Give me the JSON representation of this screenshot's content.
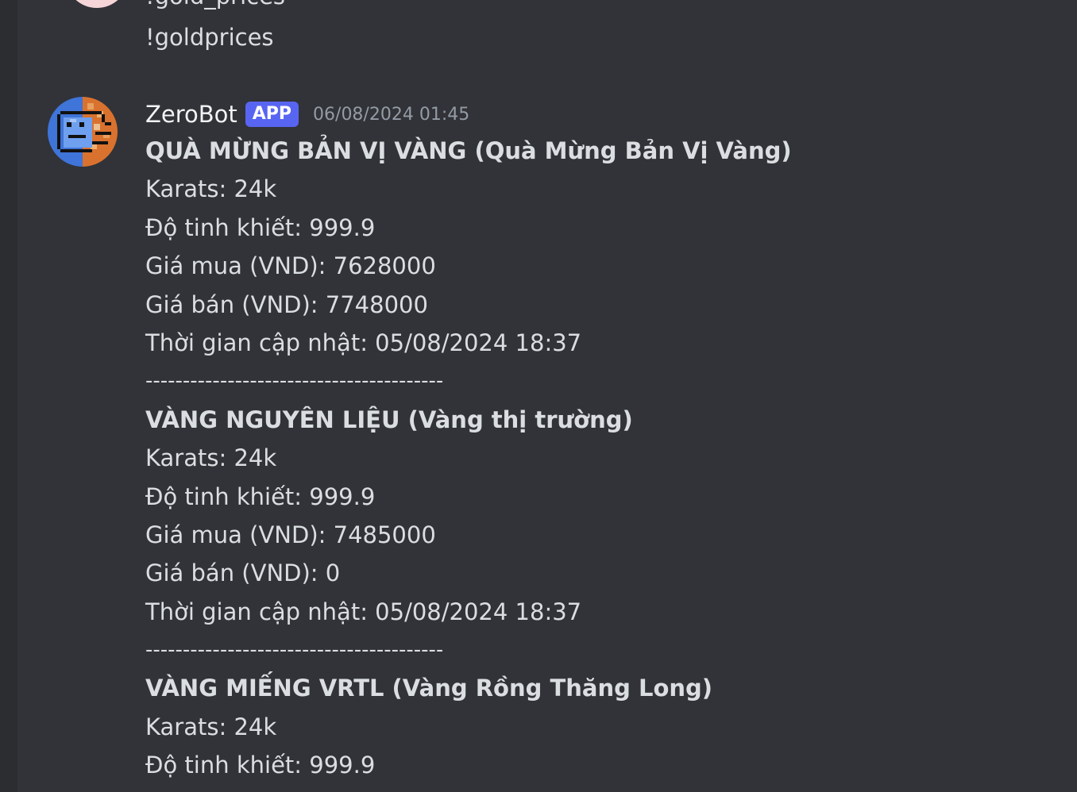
{
  "previous_message": {
    "clipped_text": "!gold_prices",
    "text": "!goldprices"
  },
  "message": {
    "username": "ZeroBot",
    "badge": "APP",
    "timestamp": "06/08/2024 01:45",
    "lines": [
      {
        "text": "QUÀ MỪNG BẢN VỊ VÀNG (Quà Mừng Bản Vị Vàng)",
        "style": "bold"
      },
      {
        "text": "Karats: 24k",
        "style": "normal"
      },
      {
        "text": "Độ tinh khiết: 999.9",
        "style": "normal"
      },
      {
        "text": "Giá mua (VND): 7628000",
        "style": "normal"
      },
      {
        "text": "Giá bán (VND): 7748000",
        "style": "normal"
      },
      {
        "text": "Thời gian cập nhật: 05/08/2024 18:37",
        "style": "normal"
      },
      {
        "text": "----------------------------------------",
        "style": "sep"
      },
      {
        "text": "VÀNG NGUYÊN LIỆU (Vàng thị trường)",
        "style": "bold"
      },
      {
        "text": "Karats: 24k",
        "style": "normal"
      },
      {
        "text": "Độ tinh khiết: 999.9",
        "style": "normal"
      },
      {
        "text": "Giá mua (VND): 7485000",
        "style": "normal"
      },
      {
        "text": "Giá bán (VND): 0",
        "style": "normal"
      },
      {
        "text": "Thời gian cập nhật: 05/08/2024 18:37",
        "style": "normal"
      },
      {
        "text": "----------------------------------------",
        "style": "sep"
      },
      {
        "text": "VÀNG MIẾNG VRTL (Vàng Rồng Thăng Long)",
        "style": "bold"
      },
      {
        "text": "Karats: 24k",
        "style": "normal"
      },
      {
        "text": "Độ tinh khiết: 999.9",
        "style": "normal"
      }
    ]
  },
  "colors": {
    "background": "#313338",
    "text": "#dbdee1",
    "username": "#f2f3f5",
    "badge": "#5865f2",
    "timestamp": "#949ba4"
  },
  "icons": {
    "bot_avatar": "pixel-art-avatar-icon",
    "previous_avatar": "user-avatar-icon"
  }
}
